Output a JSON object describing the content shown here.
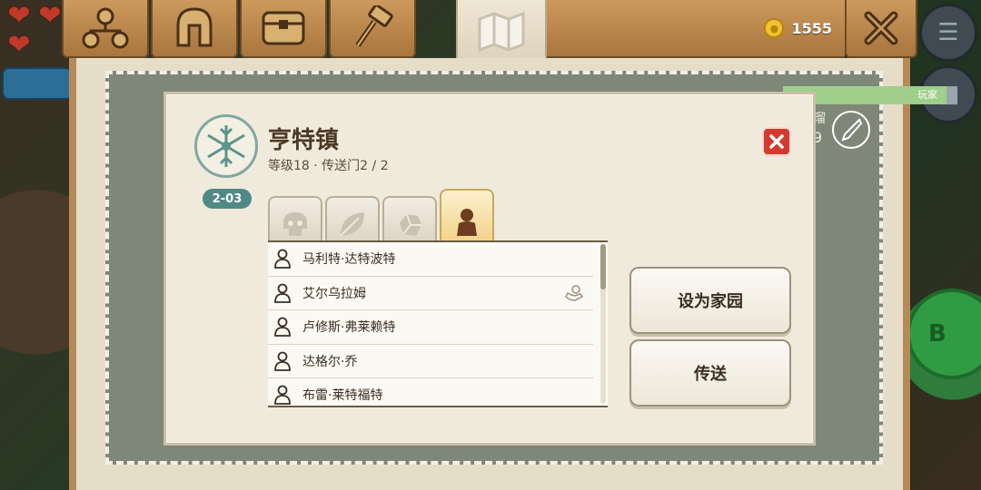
{
  "player_hearts": 3,
  "topbar": {
    "tabs": [
      {
        "icon": "network-icon"
      },
      {
        "icon": "helmet-icon"
      },
      {
        "icon": "chest-icon"
      },
      {
        "icon": "hammer-icon"
      },
      {
        "icon": "map-icon",
        "active": true
      }
    ],
    "coins": "1555"
  },
  "player_strip_label": "玩家",
  "side_number": "9",
  "side_clip_text": "瑠",
  "town": {
    "name": "亨特镇",
    "subtitle": "等级18 · 传送门2 / 2",
    "region_code": "2-03"
  },
  "category_tabs": [
    {
      "icon": "skull-icon"
    },
    {
      "icon": "leaf-icon"
    },
    {
      "icon": "ore-icon"
    },
    {
      "icon": "person-icon",
      "active": true
    }
  ],
  "residents": [
    {
      "name": "马利特·达特波特"
    },
    {
      "name": "艾尔乌拉姆",
      "extra_icon": "gift-hand-icon"
    },
    {
      "name": "卢修斯·弗莱赖特"
    },
    {
      "name": "达格尔·乔"
    },
    {
      "name": "布雷·莱特福特"
    }
  ],
  "actions": {
    "set_home": "设为家园",
    "teleport": "传送"
  },
  "b_button": "B",
  "colors": {
    "wood": "#b8864c",
    "parchment": "#f0eadc",
    "accent_teal": "#4f8a86",
    "close_red": "#d23a2d"
  }
}
